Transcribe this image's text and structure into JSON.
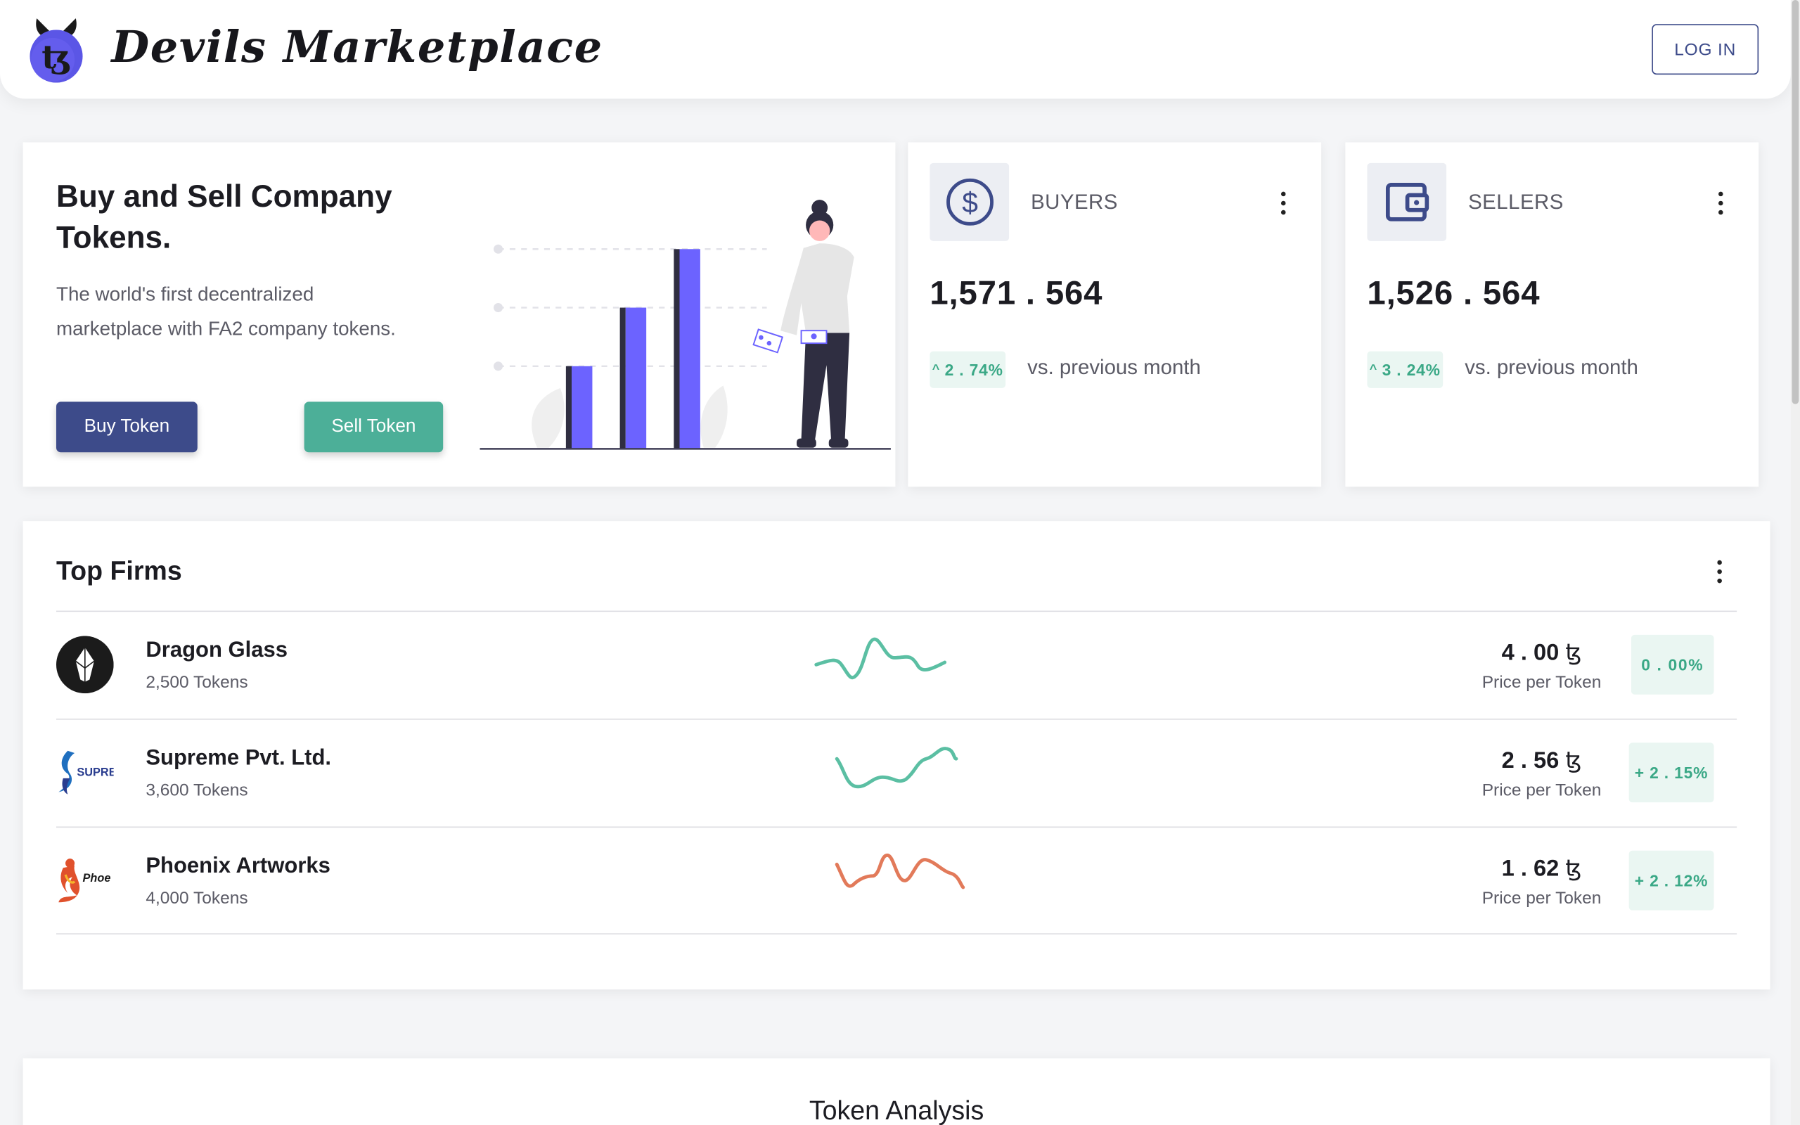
{
  "header": {
    "brand": "Devils Marketplace",
    "login_label": "LOG IN",
    "logo_icon": "devil-tezos-logo-icon"
  },
  "hero": {
    "title": "Buy and Sell Company Tokens.",
    "description": "The world's first decentralized marketplace with FA2 company tokens.",
    "buy_label": "Buy Token",
    "sell_label": "Sell Token",
    "illustration": "woman-with-bar-chart-illustration"
  },
  "stats": {
    "buyers": {
      "icon": "dollar-circle-icon",
      "title": "BUYERS",
      "value": "1,571 . 564",
      "change": "2 . 74%",
      "vs": "vs. previous month"
    },
    "sellers": {
      "icon": "wallet-icon",
      "title": "SELLERS",
      "value": "1,526 . 564",
      "change": "3 . 24%",
      "vs": "vs. previous month"
    }
  },
  "top_firms": {
    "title": "Top Firms",
    "rows": [
      {
        "name": "Dragon Glass",
        "tokens": "2,500 Tokens",
        "price": "4 . 00",
        "price_sub": "Price per Token",
        "change": "0 . 00%",
        "trend_color": "#5bbfa3"
      },
      {
        "name": "Supreme Pvt. Ltd.",
        "tokens": "3,600 Tokens",
        "price": "2 . 56",
        "price_sub": "Price per Token",
        "change": "+ 2 . 15%",
        "trend_color": "#5bbfa3",
        "logo_text": "SUPREM"
      },
      {
        "name": "Phoenix Artworks",
        "tokens": "4,000 Tokens",
        "price": "1 . 62",
        "price_sub": "Price per Token",
        "change": "+ 2 . 12%",
        "trend_color": "#e27a5a",
        "logo_text": "Phoe"
      }
    ]
  },
  "analysis": {
    "title": "Token Analysis"
  },
  "colors": {
    "primary": "#3d4b8a",
    "accent": "#4caf98",
    "bar": "#6c63ff",
    "positive": "#3aa886"
  }
}
